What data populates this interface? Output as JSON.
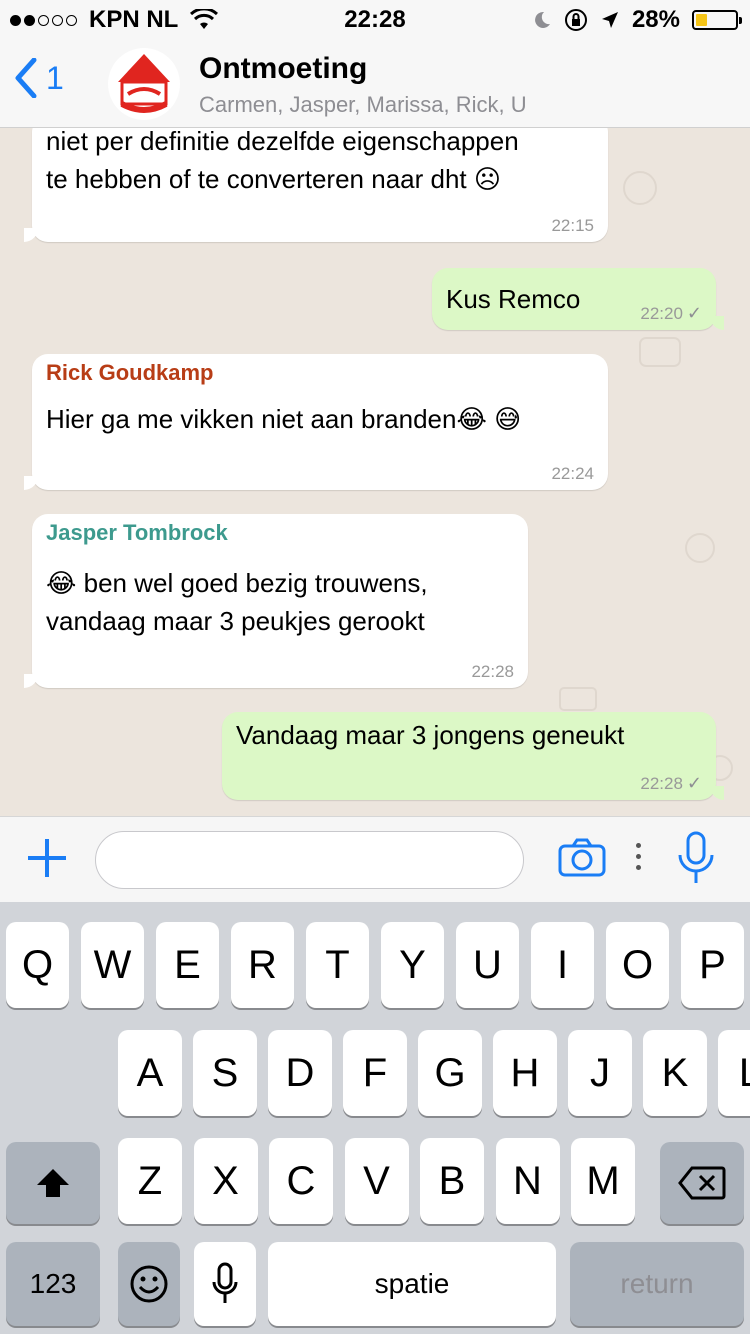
{
  "status_bar": {
    "carrier": "KPN NL",
    "signal_bars_filled": 2,
    "signal_bars_total": 5,
    "time": "22:28",
    "battery_percent": "28%",
    "battery_level": 0.28,
    "battery_color": "#f5c518"
  },
  "nav": {
    "back_count": "1",
    "title": "Ontmoeting",
    "subtitle": "Carmen, Jasper, Marissa, Rick, U",
    "avatar_color": "#e0251f",
    "accent": "#1a7df5"
  },
  "messages": [
    {
      "direction": "in",
      "line1": "niet per definitie dezelfde eigenschappen",
      "line2": "te hebben of te converteren naar dht ☹",
      "time": "22:15"
    },
    {
      "direction": "out",
      "text": "Kus Remco",
      "time": "22:20"
    },
    {
      "direction": "in",
      "sender": "Rick Goudkamp",
      "sender_color": "#b83d16",
      "text": "Hier ga me vikken niet aan branden😂 😅",
      "time": "22:24"
    },
    {
      "direction": "in",
      "sender": "Jasper Tombrock",
      "sender_color": "#3d9a8e",
      "line1": "😂 ben wel goed bezig trouwens,",
      "line2": "vandaag maar 3 peukjes gerookt",
      "time": "22:28"
    },
    {
      "direction": "out",
      "text": "Vandaag maar 3 jongens geneukt",
      "time": "22:28"
    }
  ],
  "input": {
    "value": "",
    "placeholder": ""
  },
  "keyboard": {
    "row1": [
      "Q",
      "W",
      "E",
      "R",
      "T",
      "Y",
      "U",
      "I",
      "O",
      "P"
    ],
    "row2": [
      "A",
      "S",
      "D",
      "F",
      "G",
      "H",
      "J",
      "K",
      "L"
    ],
    "row3": [
      "Z",
      "X",
      "C",
      "V",
      "B",
      "N",
      "M"
    ],
    "numbers_label": "123",
    "space_label": "spatie",
    "return_label": "return"
  }
}
